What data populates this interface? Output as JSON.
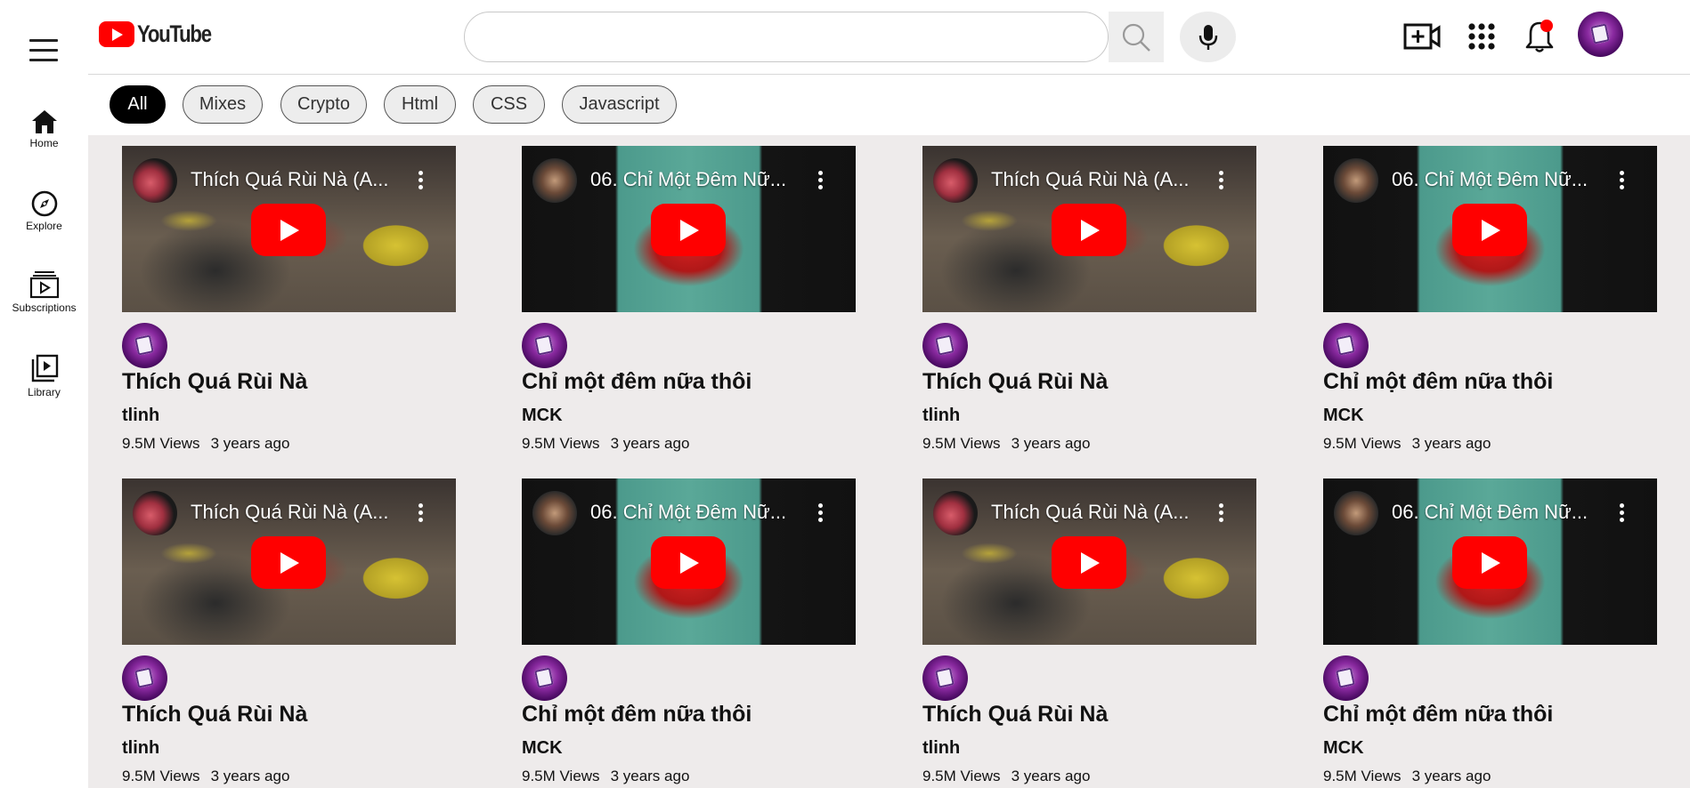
{
  "sidebar": {
    "items": [
      {
        "label": "Home",
        "icon": "home-icon"
      },
      {
        "label": "Explore",
        "icon": "compass-icon"
      },
      {
        "label": "Subscriptions",
        "icon": "subscriptions-icon"
      },
      {
        "label": "Library",
        "icon": "library-icon"
      }
    ]
  },
  "header": {
    "logo_text": "YouTube",
    "search_placeholder": "",
    "icons": [
      "create-video-icon",
      "apps-icon",
      "notifications-icon"
    ],
    "notification_dot_color": "#ff0000"
  },
  "chips": [
    {
      "label": "All",
      "active": true
    },
    {
      "label": "Mixes"
    },
    {
      "label": "Crypto"
    },
    {
      "label": "Html"
    },
    {
      "label": "CSS"
    },
    {
      "label": "Javascript"
    }
  ],
  "videos": [
    {
      "thumb_title": "Thích Quá Rùi Nà (A...",
      "title": "Thích Quá Rùi Nà",
      "channel": "tlinh",
      "views": "9.5M Views",
      "age": "3 years ago"
    },
    {
      "thumb_title": "06. Chỉ Một Đêm Nữ...",
      "title": "Chỉ một đêm nữa thôi",
      "channel": "MCK",
      "views": "9.5M Views",
      "age": "3 years ago"
    },
    {
      "thumb_title": "Thích Quá Rùi Nà (A...",
      "title": "Thích Quá Rùi Nà",
      "channel": "tlinh",
      "views": "9.5M Views",
      "age": "3 years ago"
    },
    {
      "thumb_title": "06. Chỉ Một Đêm Nữ...",
      "title": "Chỉ một đêm nữa thôi",
      "channel": "MCK",
      "views": "9.5M Views",
      "age": "3 years ago"
    },
    {
      "thumb_title": "Thích Quá Rùi Nà (A...",
      "title": "Thích Quá Rùi Nà",
      "channel": "tlinh",
      "views": "9.5M Views",
      "age": "3 years ago"
    },
    {
      "thumb_title": "06. Chỉ Một Đêm Nữ...",
      "title": "Chỉ một đêm nữa thôi",
      "channel": "MCK",
      "views": "9.5M Views",
      "age": "3 years ago"
    },
    {
      "thumb_title": "Thích Quá Rùi Nà (A...",
      "title": "Thích Quá Rùi Nà",
      "channel": "tlinh",
      "views": "9.5M Views",
      "age": "3 years ago"
    },
    {
      "thumb_title": "06. Chỉ Một Đêm Nữ...",
      "title": "Chỉ một đêm nữa thôi",
      "channel": "MCK",
      "views": "9.5M Views",
      "age": "3 years ago"
    }
  ],
  "colors": {
    "brand_red": "#ff0000",
    "content_bg": "#eeebeb",
    "active_chip_bg": "#000000"
  }
}
